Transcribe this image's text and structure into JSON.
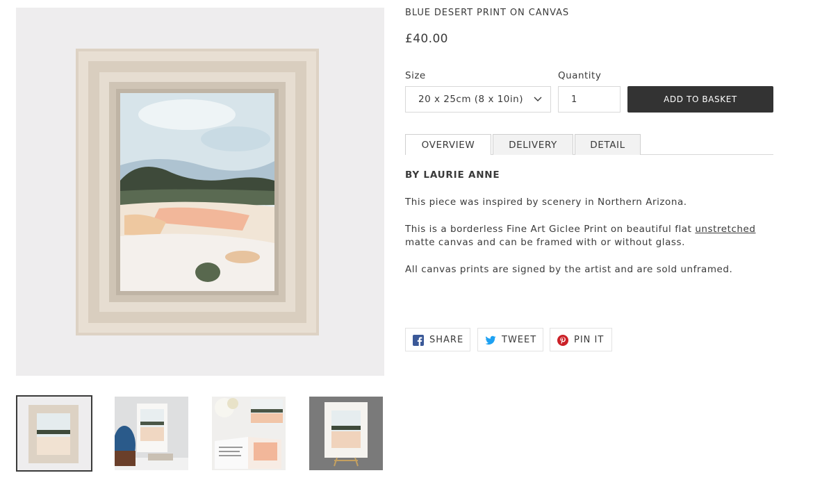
{
  "product": {
    "title": "BLUE DESERT PRINT ON CANVAS",
    "price": "£40.00"
  },
  "options": {
    "size_label": "Size",
    "size_value": "20 x 25cm (8 x 10in)",
    "quantity_label": "Quantity",
    "quantity_value": "1",
    "add_to_basket": "ADD TO BASKET"
  },
  "tabs": [
    {
      "label": "OVERVIEW",
      "active": true
    },
    {
      "label": "DELIVERY",
      "active": false
    },
    {
      "label": "DETAIL",
      "active": false
    }
  ],
  "description": {
    "artist": "BY LAURIE ANNE",
    "p1": "This piece was inspired by scenery in Northern Arizona.",
    "p2_before": "This is a borderless Fine Art Giclee Print on beautiful flat ",
    "p2_link": "unstretched",
    "p2_after": " matte canvas and can be framed with or without glass.",
    "p3": "All canvas prints are signed by the artist and are sold unframed."
  },
  "share": {
    "facebook": "SHARE",
    "twitter": "TWEET",
    "pinterest": "PIN IT"
  },
  "colors": {
    "button_bg": "#333333",
    "facebook": "#3b5998",
    "twitter": "#1da1f2",
    "pinterest": "#cb2027"
  },
  "icons": [
    "chevron-down-icon",
    "facebook-icon",
    "twitter-icon",
    "pinterest-icon"
  ]
}
